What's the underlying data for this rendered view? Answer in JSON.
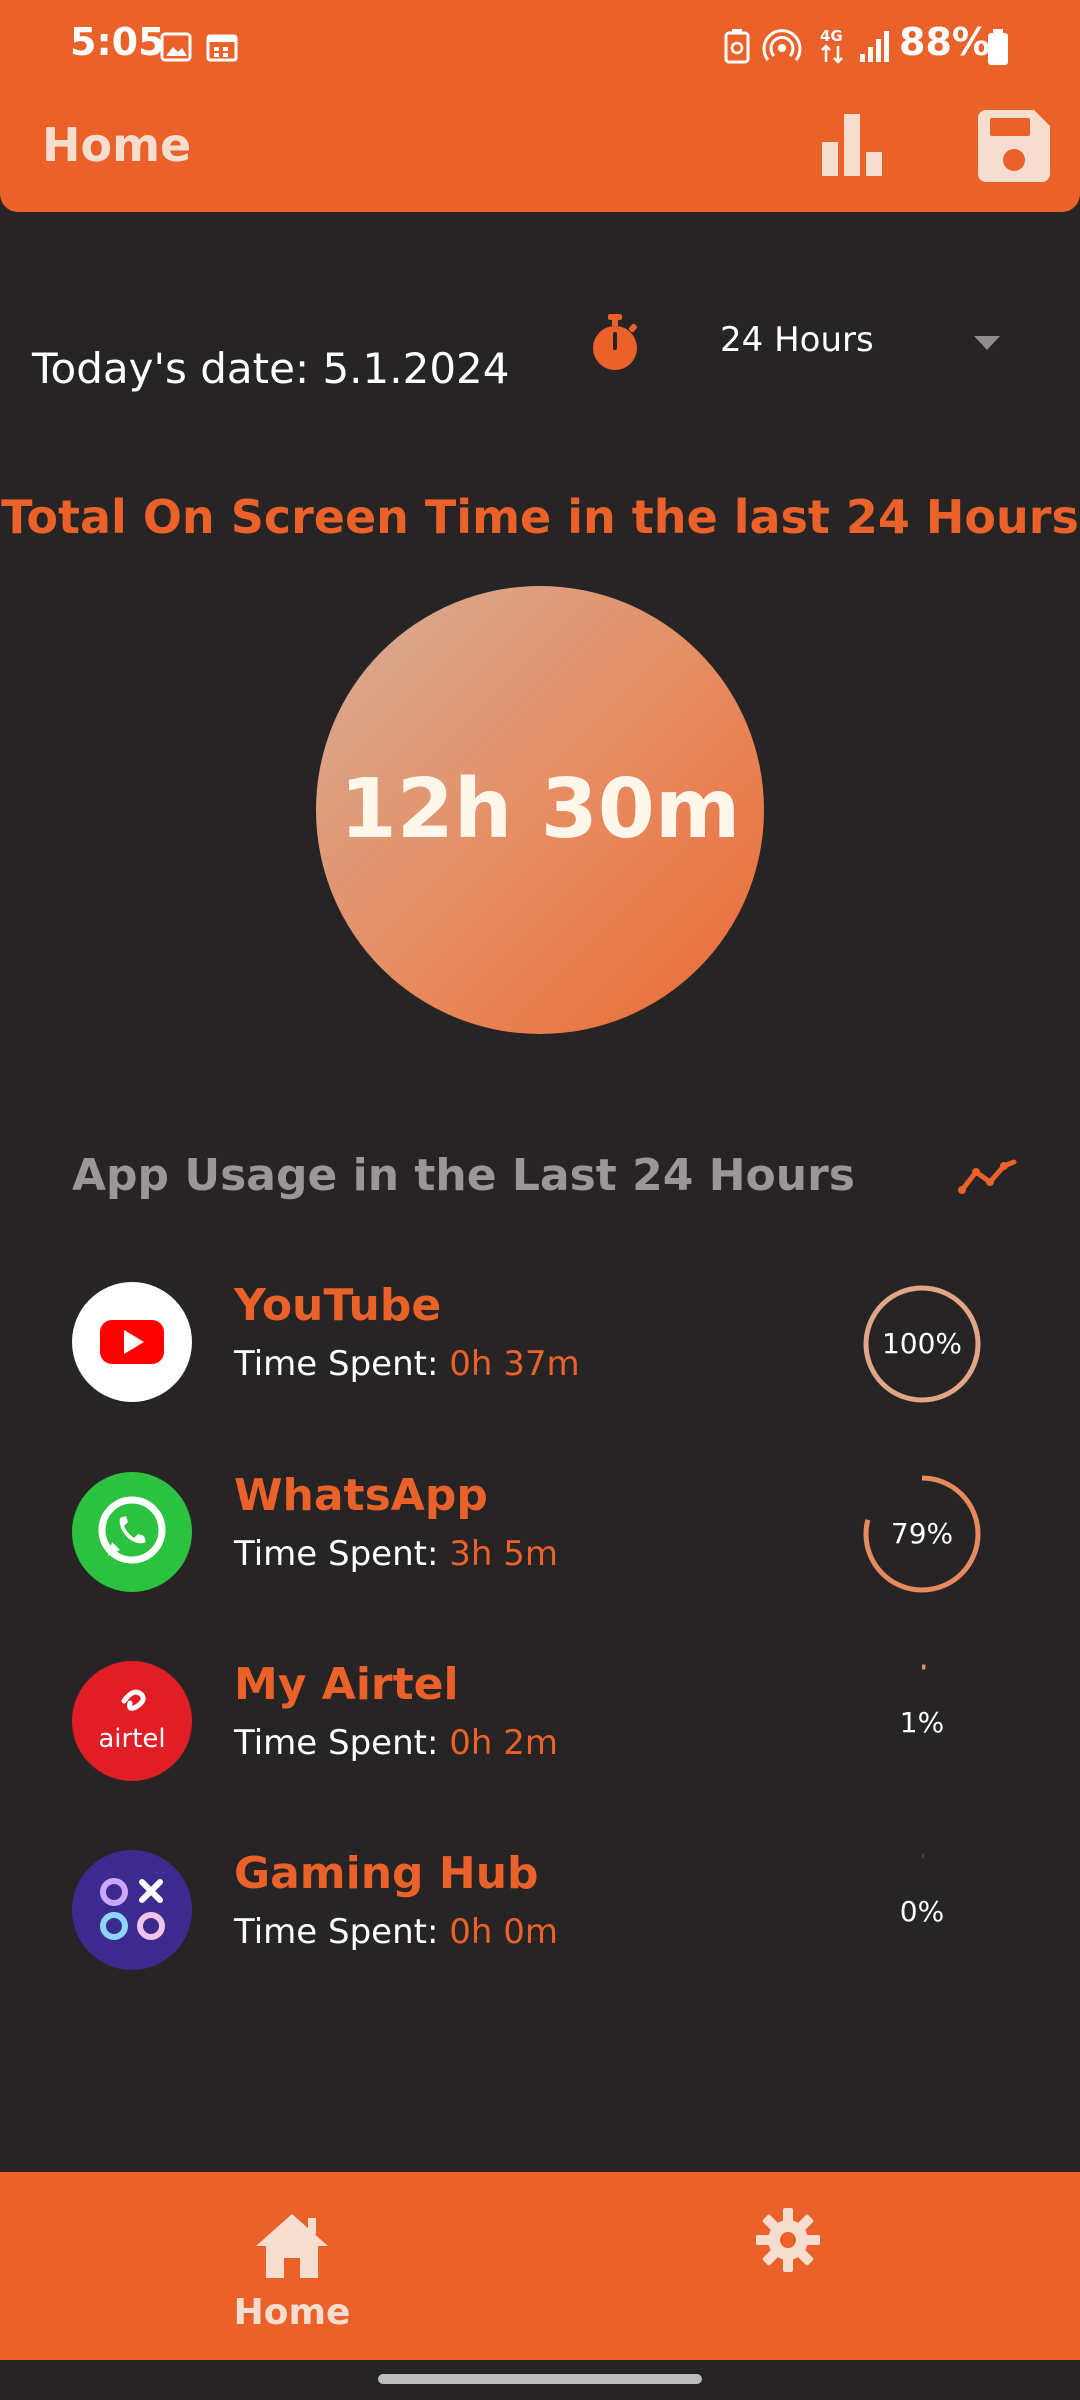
{
  "status_bar": {
    "time": "5:05",
    "battery": "88%"
  },
  "app_bar": {
    "title": "Home"
  },
  "date_row": {
    "date_text": "Today's date: 5.1.2024",
    "range_selected": "24 Hours"
  },
  "headline": "Total On Screen Time in the last 24 Hours",
  "total_time": "12h 30m",
  "section_title": "App Usage in the Last 24 Hours",
  "apps": [
    {
      "name": "YouTube",
      "label": "Time Spent:",
      "time": "0h 37m",
      "percent_text": "100%",
      "progress": 1.0,
      "icon": "youtube-icon"
    },
    {
      "name": "WhatsApp",
      "label": "Time Spent:",
      "time": "3h 5m",
      "percent_text": "79%",
      "progress": 0.79,
      "icon": "whatsapp-icon"
    },
    {
      "name": "My Airtel",
      "label": "Time Spent:",
      "time": "0h 2m",
      "percent_text": "1%",
      "progress": 0.01,
      "icon": "airtel-icon",
      "icon_text": "airtel"
    },
    {
      "name": "Gaming Hub",
      "label": "Time Spent:",
      "time": "0h 0m",
      "percent_text": "0%",
      "progress": 0.0,
      "icon": "gaming-hub-icon"
    }
  ],
  "bottom_nav": {
    "home_label": "Home"
  },
  "colors": {
    "accent": "#EA6129",
    "background": "#262424",
    "muted_text": "#9A9797"
  }
}
